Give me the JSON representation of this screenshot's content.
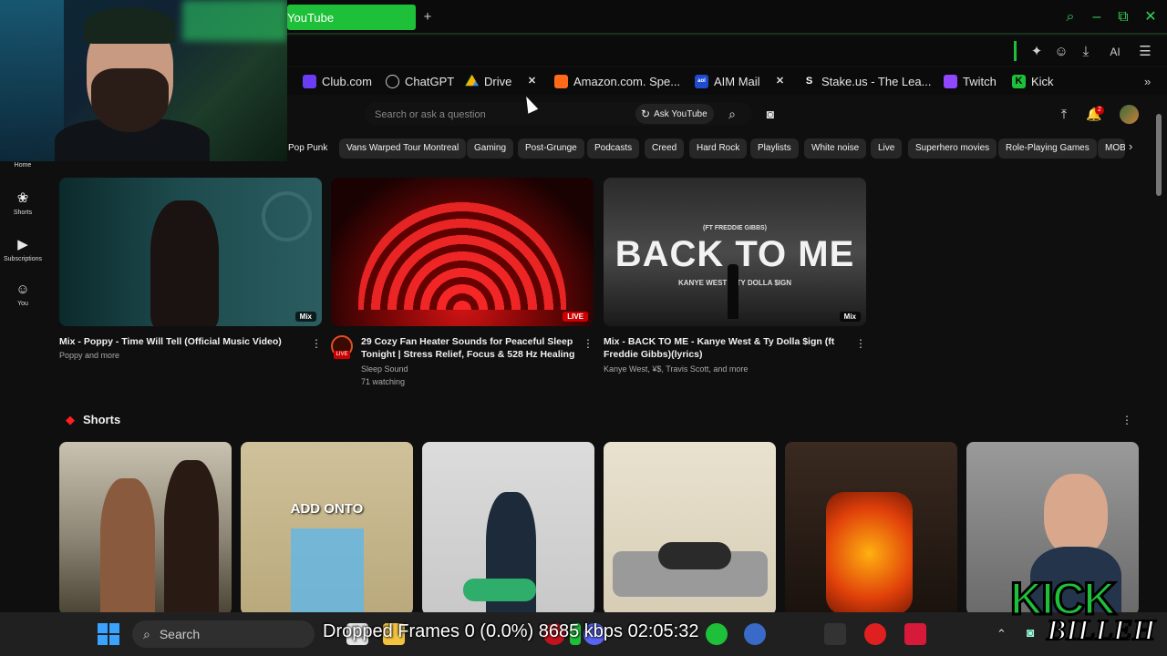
{
  "browser": {
    "active_tab": "YouTube",
    "new_tab_symbol": "+",
    "ai_label": "AI",
    "bookmarks": [
      {
        "label": "Club.com"
      },
      {
        "label": "ChatGPT"
      },
      {
        "label": "Drive"
      },
      {
        "label": ""
      },
      {
        "label": "Amazon.com. Spe..."
      },
      {
        "label": "AIM Mail"
      },
      {
        "label": ""
      },
      {
        "label": "Stake.us - The Lea..."
      },
      {
        "label": "Twitch"
      },
      {
        "label": "Kick"
      }
    ]
  },
  "youtube": {
    "search_placeholder": "Search or ask a question",
    "ask_button": "Ask YouTube",
    "notification_count": "2",
    "chips": [
      "Pop Punk",
      "Vans Warped Tour Montreal",
      "Gaming",
      "Post-Grunge",
      "Podcasts",
      "Creed",
      "Hard Rock",
      "Playlists",
      "White noise",
      "Live",
      "Superhero movies",
      "Role-Playing Games",
      "MOBA"
    ],
    "sidebar": [
      {
        "label": "Home"
      },
      {
        "label": "Shorts"
      },
      {
        "label": "Subscriptions"
      },
      {
        "label": "You"
      }
    ],
    "videos": [
      {
        "title": "Mix - Poppy - Time Will Tell (Official Music Video)",
        "title2": "",
        "meta1": "Poppy and more",
        "meta2": "",
        "badge": "Mix"
      },
      {
        "title": "29 Cozy Fan Heater Sounds for Peaceful Sleep",
        "title2": "Tonight | Stress Relief, Focus & 528 Hz Healing",
        "meta1": "Sleep Sound",
        "meta2": "71 watching",
        "badge": "LIVE",
        "avatar_badge": "LIVE"
      },
      {
        "title": "Mix - BACK TO ME - Kanye West & Ty Dolla $ign (ft",
        "title2": "Freddie Gibbs)(lyrics)",
        "meta1": "Kanye West, ¥$, Travis Scott, and more",
        "meta2": "",
        "badge": "Mix",
        "thumb_small": "(FT FREDDIE GIBBS)",
        "thumb_big": "BACK TO ME",
        "thumb_sub": "KANYE WEST & TY DOLLA $IGN"
      }
    ],
    "shorts_heading": "Shorts",
    "short_text": "ADD ONTO"
  },
  "taskbar": {
    "search_label": "Search",
    "stream_stats": "Dropped Frames 0 (0.0%)  8685 kbps  02:05:32"
  },
  "overlay": {
    "logo_text": "KICK",
    "logo_script": "BILLEH"
  },
  "colors": {
    "accent_green": "#1ec03a",
    "live_red": "#cc0000",
    "yt_bg": "#0f0f0f"
  }
}
